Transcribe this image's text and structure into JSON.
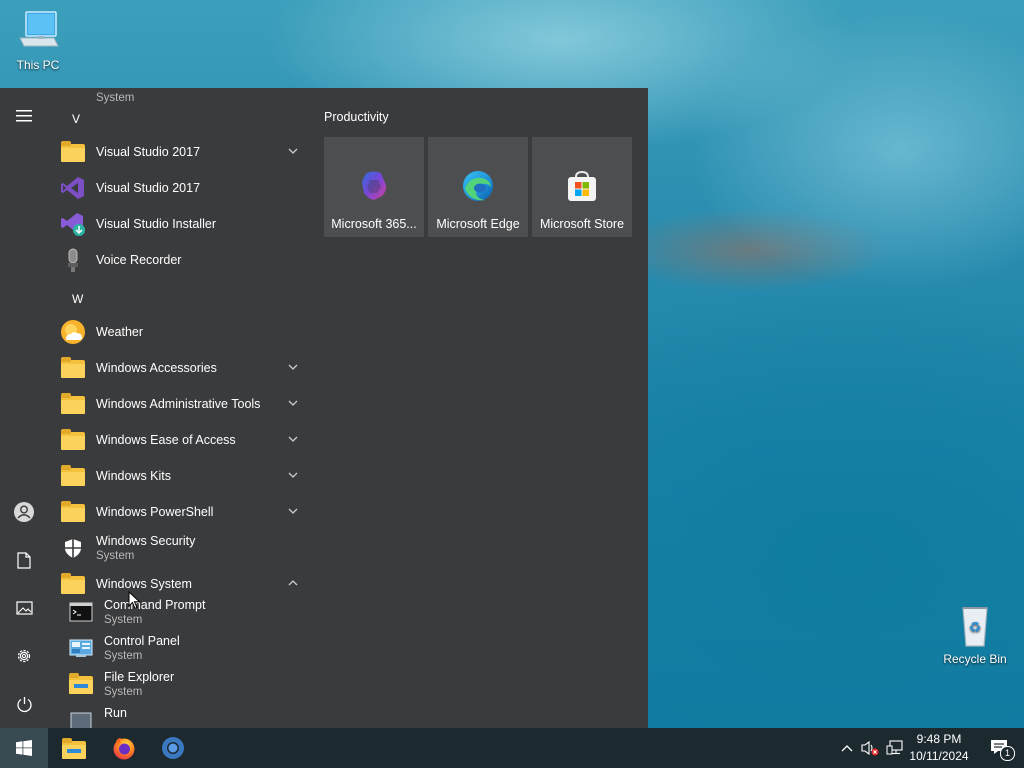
{
  "desktop": {
    "icons": [
      {
        "label": "This PC",
        "icon": "this-pc-icon"
      },
      {
        "label": "Recycle Bin",
        "icon": "recycle-bin-icon"
      }
    ]
  },
  "start_menu": {
    "rail": [
      {
        "name": "hamburger-menu",
        "icon": "menu-icon"
      },
      {
        "name": "account",
        "icon": "user-icon"
      },
      {
        "name": "documents",
        "icon": "document-icon"
      },
      {
        "name": "pictures",
        "icon": "pictures-icon"
      },
      {
        "name": "settings",
        "icon": "gear-icon"
      },
      {
        "name": "power",
        "icon": "power-icon"
      }
    ],
    "partial_top_sub": "System",
    "letter_v": "V",
    "letter_w": "W",
    "apps": [
      {
        "label": "Visual Studio 2017",
        "icon": "folder-icon",
        "expandable": true
      },
      {
        "label": "Visual Studio 2017",
        "icon": "visual-studio-icon"
      },
      {
        "label": "Visual Studio Installer",
        "icon": "vs-installer-icon"
      },
      {
        "label": "Voice Recorder",
        "icon": "microphone-icon"
      },
      {
        "label": "Weather",
        "icon": "weather-icon"
      },
      {
        "label": "Windows Accessories",
        "icon": "folder-icon",
        "expandable": true
      },
      {
        "label": "Windows Administrative Tools",
        "icon": "folder-icon",
        "expandable": true
      },
      {
        "label": "Windows Ease of Access",
        "icon": "folder-icon",
        "expandable": true
      },
      {
        "label": "Windows Kits",
        "icon": "folder-icon",
        "expandable": true
      },
      {
        "label": "Windows PowerShell",
        "icon": "folder-icon",
        "expandable": true
      },
      {
        "label": "Windows Security",
        "sub": "System",
        "icon": "shield-icon"
      },
      {
        "label": "Windows System",
        "icon": "folder-icon",
        "expanded": true
      }
    ],
    "windows_system_children": [
      {
        "label": "Command Prompt",
        "sub": "System",
        "icon": "command-prompt-icon"
      },
      {
        "label": "Control Panel",
        "sub": "System",
        "icon": "control-panel-icon"
      },
      {
        "label": "File Explorer",
        "sub": "System",
        "icon": "file-explorer-icon"
      },
      {
        "label": "Run",
        "icon": "run-icon"
      }
    ],
    "tile_group": {
      "title": "Productivity",
      "tiles": [
        {
          "label": "Microsoft 365...",
          "icon": "microsoft-365-icon"
        },
        {
          "label": "Microsoft Edge",
          "icon": "edge-icon"
        },
        {
          "label": "Microsoft Store",
          "icon": "store-icon"
        }
      ]
    }
  },
  "taskbar": {
    "pinned": [
      {
        "name": "file-explorer",
        "icon": "folder-icon"
      },
      {
        "name": "firefox",
        "icon": "firefox-icon"
      },
      {
        "name": "chrome",
        "icon": "chrome-icon"
      }
    ],
    "clock": {
      "time": "9:48 PM",
      "date": "10/11/2024"
    },
    "notification_count": "1"
  },
  "colors": {
    "start_menu_bg": "#3a3b3d",
    "tile_bg": "#4d4e50",
    "taskbar_bg": "#1c2a30",
    "folder": "#f4c13c"
  }
}
